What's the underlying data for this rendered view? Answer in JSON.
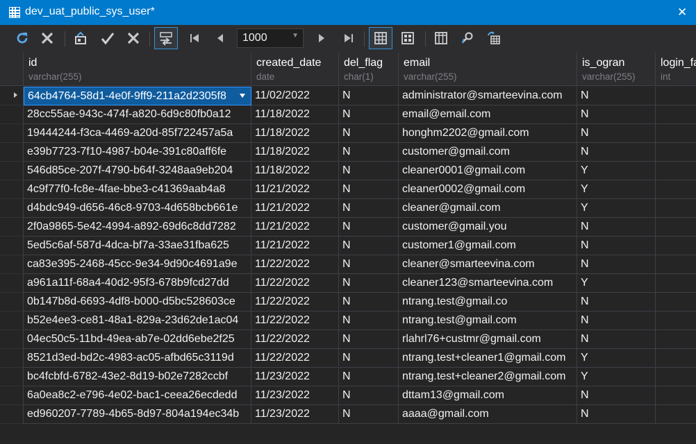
{
  "window": {
    "title": "dev_uat_public_sys_user*",
    "title_icon": "table-icon",
    "close_label": "✕"
  },
  "toolbar": {
    "refresh_icon": "refresh-icon",
    "cancel_icon": "cancel-icon",
    "save_icon": "save-icon",
    "apply_icon": "apply-icon",
    "discard_icon": "discard-icon",
    "transpose_icon": "transpose-icon",
    "first_page_icon": "first-page-icon",
    "prev_page_icon": "prev-page-icon",
    "limit_value": "1000",
    "next_page_icon": "next-page-icon",
    "last_page_icon": "last-page-icon",
    "grid_view_icon": "grid-view-icon",
    "form_view_icon": "form-view-icon",
    "columns_icon": "columns-icon",
    "filter_icon": "filter-icon",
    "export_icon": "export-icon"
  },
  "table": {
    "columns": [
      {
        "name": "id",
        "type": "varchar(255)"
      },
      {
        "name": "created_date",
        "type": "date"
      },
      {
        "name": "del_flag",
        "type": "char(1)"
      },
      {
        "name": "email",
        "type": "varchar(255)"
      },
      {
        "name": "is_ogran",
        "type": "varchar(255)"
      },
      {
        "name": "login_fa",
        "type": "int"
      }
    ],
    "rows": [
      {
        "id": "64cb4764-58d1-4e0f-9ff9-211a2d2305f8",
        "created_date": "11/02/2022",
        "del_flag": "N",
        "email": "administrator@smarteevina.com",
        "is_ogran": "N",
        "login": ""
      },
      {
        "id": "28cc55ae-943c-474f-a820-6d9c80fb0a12",
        "created_date": "11/18/2022",
        "del_flag": "N",
        "email": "email@email.com",
        "is_ogran": "N",
        "login": ""
      },
      {
        "id": "19444244-f3ca-4469-a20d-85f722457a5a",
        "created_date": "11/18/2022",
        "del_flag": "N",
        "email": "honghm2202@gmail.com",
        "is_ogran": "N",
        "login": ""
      },
      {
        "id": "e39b7723-7f10-4987-b04e-391c80aff6fe",
        "created_date": "11/18/2022",
        "del_flag": "N",
        "email": "customer@gmail.com",
        "is_ogran": "N",
        "login": ""
      },
      {
        "id": "546d85ce-207f-4790-b64f-3248aa9eb204",
        "created_date": "11/18/2022",
        "del_flag": "N",
        "email": "cleaner0001@gmail.com",
        "is_ogran": "Y",
        "login": ""
      },
      {
        "id": "4c9f77f0-fc8e-4fae-bbe3-c41369aab4a8",
        "created_date": "11/21/2022",
        "del_flag": "N",
        "email": "cleaner0002@gmail.com",
        "is_ogran": "Y",
        "login": ""
      },
      {
        "id": "d4bdc949-d656-46c8-9703-4d658bcb661e",
        "created_date": "11/21/2022",
        "del_flag": "N",
        "email": "cleaner@gmail.com",
        "is_ogran": "Y",
        "login": ""
      },
      {
        "id": "2f0a9865-5e42-4994-a892-69d6c8dd7282",
        "created_date": "11/21/2022",
        "del_flag": "N",
        "email": "customer@gmail.you",
        "is_ogran": "N",
        "login": ""
      },
      {
        "id": "5ed5c6af-587d-4dca-bf7a-33ae31fba625",
        "created_date": "11/21/2022",
        "del_flag": "N",
        "email": "customer1@gmail.com",
        "is_ogran": "N",
        "login": ""
      },
      {
        "id": "ca83e395-2468-45cc-9e34-9d90c4691a9e",
        "created_date": "11/22/2022",
        "del_flag": "N",
        "email": "cleaner@smarteevina.com",
        "is_ogran": "N",
        "login": ""
      },
      {
        "id": "a961a11f-68a4-40d2-95f3-678b9fcd27dd",
        "created_date": "11/22/2022",
        "del_flag": "N",
        "email": "cleaner123@smarteevina.com",
        "is_ogran": "Y",
        "login": ""
      },
      {
        "id": "0b147b8d-6693-4df8-b000-d5bc528603ce",
        "created_date": "11/22/2022",
        "del_flag": "N",
        "email": "ntrang.test@gmail.co",
        "is_ogran": "N",
        "login": ""
      },
      {
        "id": "b52e4ee3-ce81-48a1-829a-23d62de1ac04",
        "created_date": "11/22/2022",
        "del_flag": "N",
        "email": "ntrang.test@gmail.com",
        "is_ogran": "N",
        "login": ""
      },
      {
        "id": "04ec50c5-11bd-49ea-ab7e-02dd6ebe2f25",
        "created_date": "11/22/2022",
        "del_flag": "N",
        "email": "rlahrl76+custmr@gmail.com",
        "is_ogran": "N",
        "login": ""
      },
      {
        "id": "8521d3ed-bd2c-4983-ac05-afbd65c3119d",
        "created_date": "11/22/2022",
        "del_flag": "N",
        "email": "ntrang.test+cleaner1@gmail.com",
        "is_ogran": "Y",
        "login": ""
      },
      {
        "id": "bc4fcbfd-6782-43e2-8d19-b02e7282ccbf",
        "created_date": "11/23/2022",
        "del_flag": "N",
        "email": "ntrang.test+cleaner2@gmail.com",
        "is_ogran": "Y",
        "login": ""
      },
      {
        "id": "6a0ea8c2-e796-4e02-bac1-ceea26ecdedd",
        "created_date": "11/23/2022",
        "del_flag": "N",
        "email": "dttam13@gmail.com",
        "is_ogran": "N",
        "login": ""
      },
      {
        "id": "ed960207-7789-4b65-8d97-804a194ec34b",
        "created_date": "11/23/2022",
        "del_flag": "N",
        "email": "aaaa@gmail.com",
        "is_ogran": "N",
        "login": ""
      }
    ]
  },
  "colors": {
    "title_bar": "#007acc",
    "selected_cell": "#0f5c9e",
    "background": "#252526"
  }
}
